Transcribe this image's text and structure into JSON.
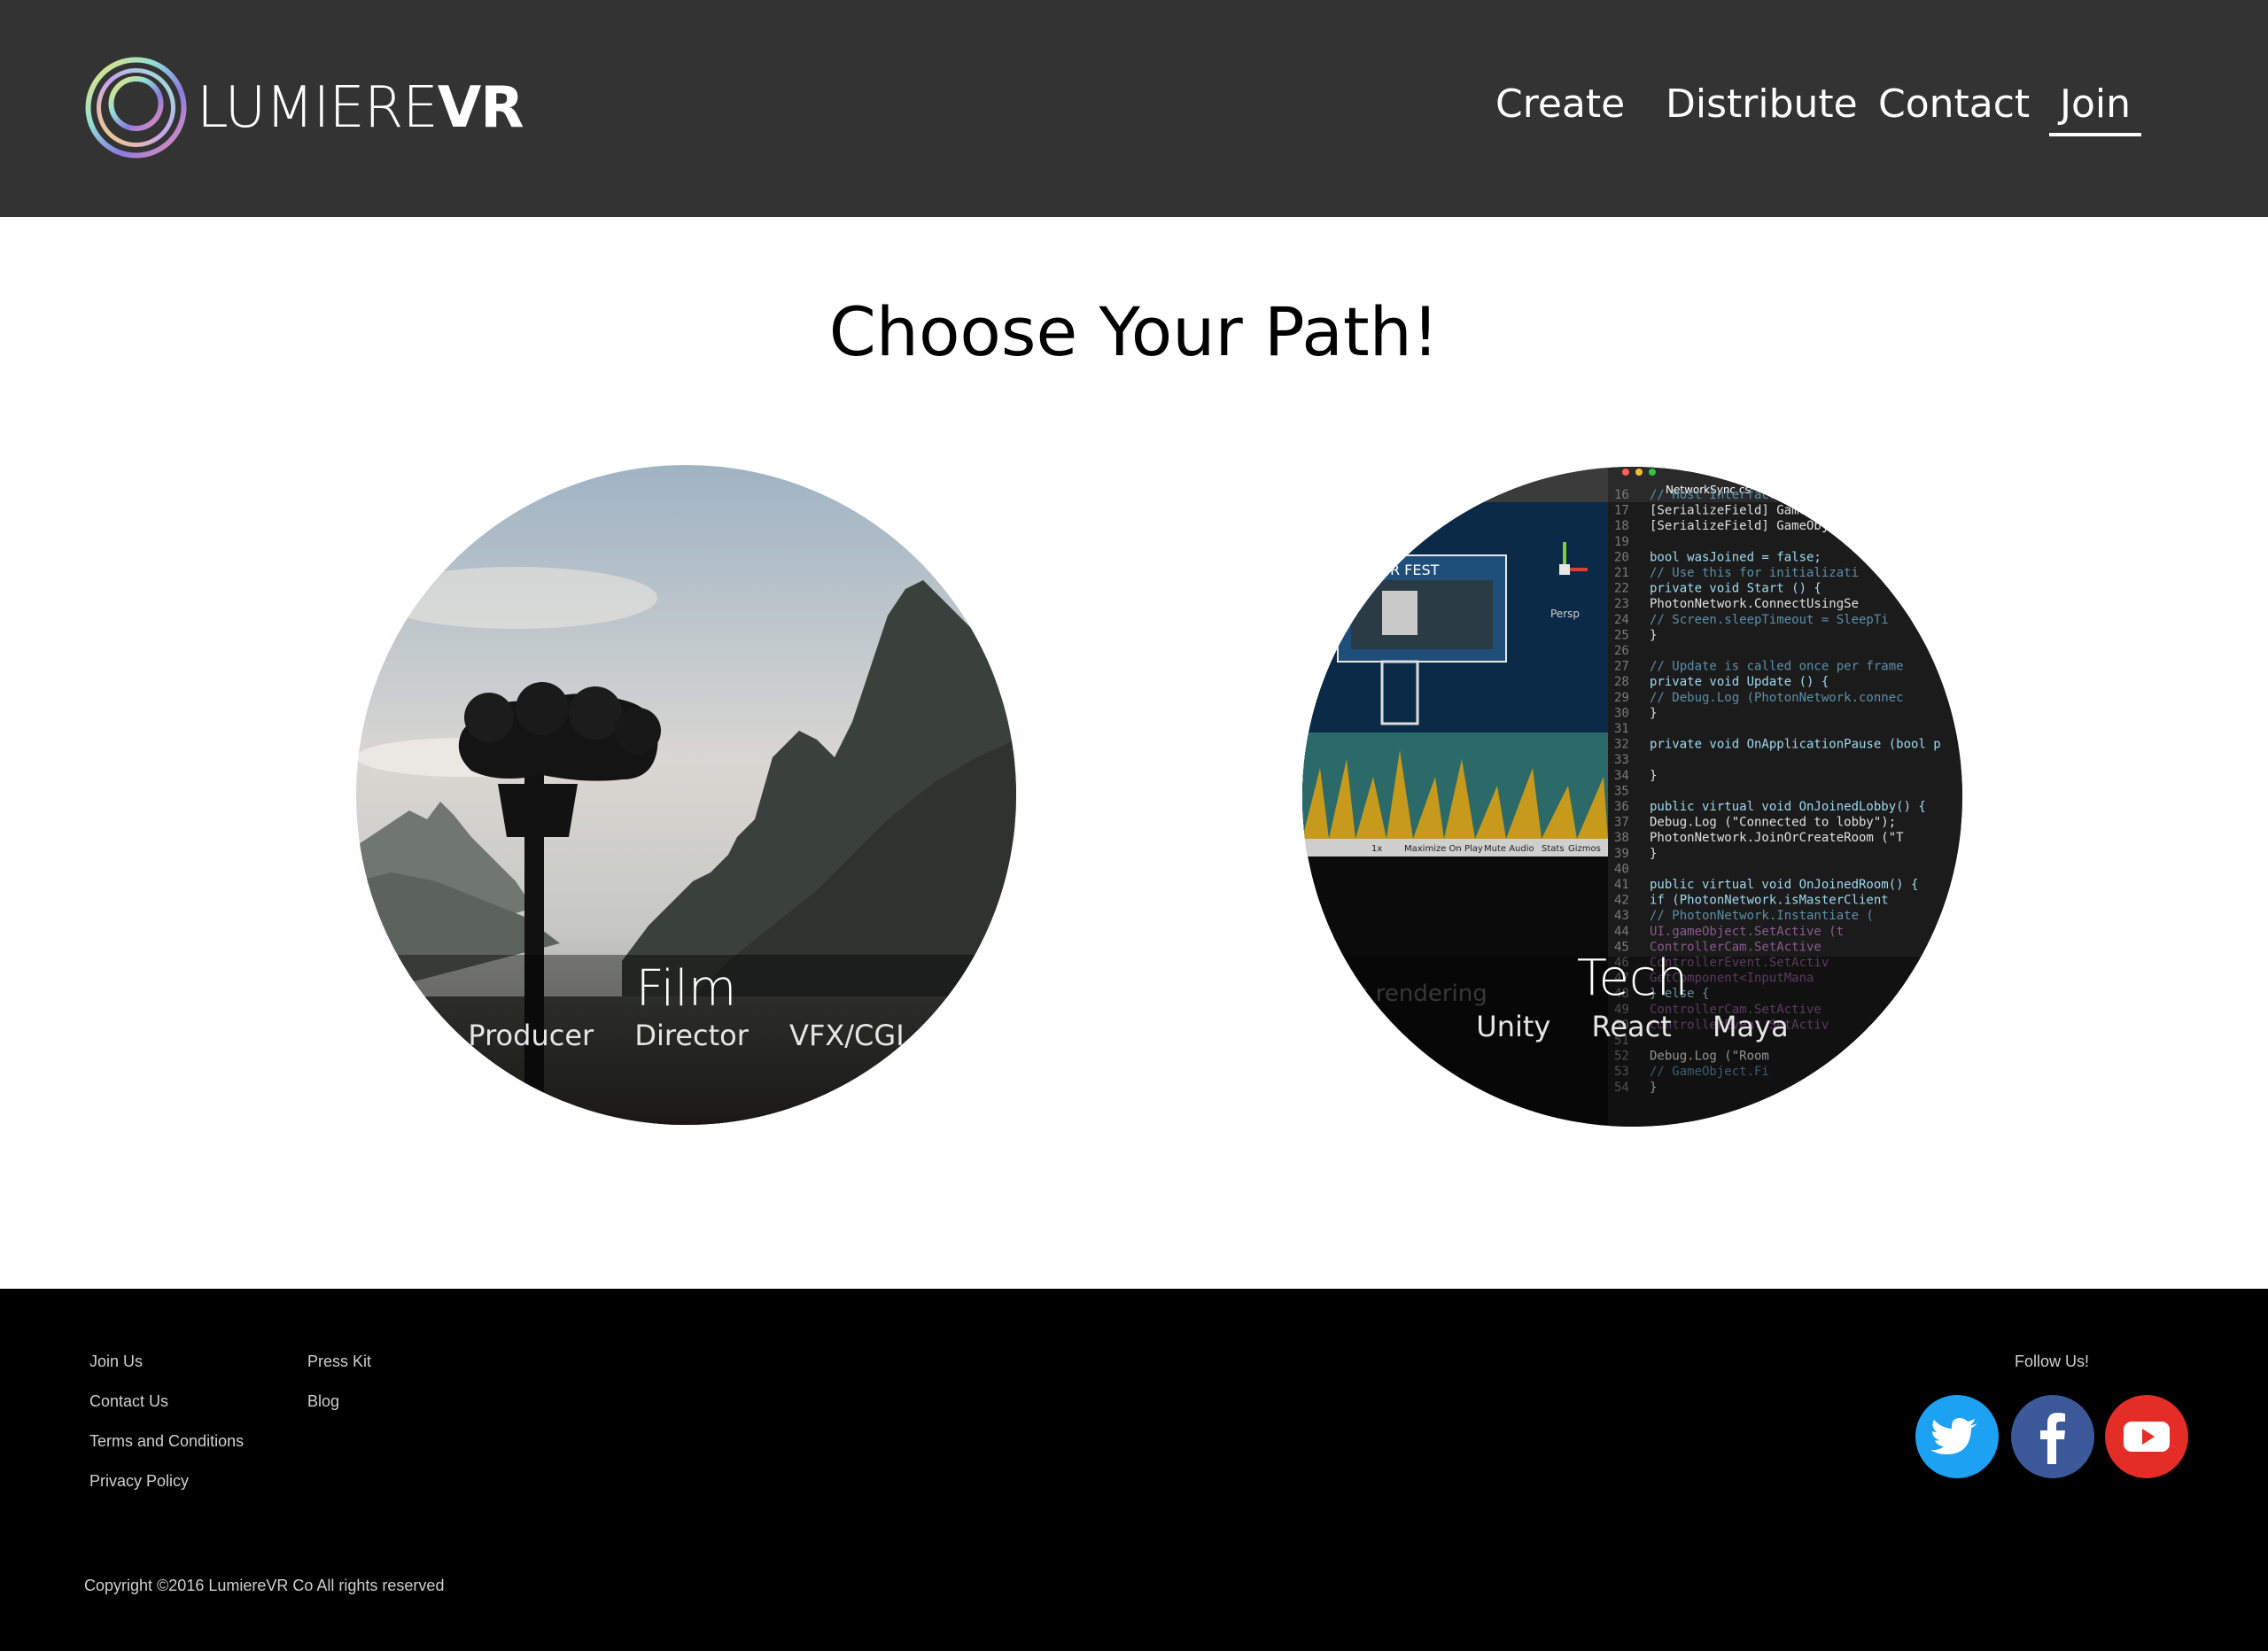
{
  "header": {
    "logo_light": "LUMIERE",
    "logo_bold": "VR",
    "nav": {
      "create": "Create",
      "distribute": "Distribute",
      "contact": "Contact",
      "join": "Join"
    },
    "active_nav": "Join"
  },
  "main": {
    "title": "Choose Your Path!",
    "paths": {
      "film": {
        "title": "Film",
        "roles": [
          "Producer",
          "Director",
          "VFX/CGI"
        ]
      },
      "tech": {
        "title": "Tech",
        "roles": [
          "Unity",
          "React",
          "Maya"
        ]
      }
    },
    "tech_image": {
      "editor_tab": "NetworkSync.cs",
      "fest_label": "VR FEST",
      "persp_label": "Persp",
      "status_text": "as rendering",
      "toolbar": [
        "1x",
        "Maximize On Play",
        "Mute Audio",
        "Stats",
        "Gizmos"
      ],
      "line_numbers": [
        "16",
        "17",
        "18",
        "19",
        "20",
        "21",
        "22",
        "23",
        "24",
        "25",
        "26",
        "27",
        "28",
        "29",
        "30",
        "31",
        "32",
        "33",
        "34",
        "35",
        "36",
        "37",
        "38",
        "39",
        "40",
        "41",
        "42",
        "43",
        "44",
        "45",
        "46",
        "47",
        "48",
        "49",
        "50",
        "51",
        "52",
        "53",
        "54"
      ],
      "code_lines": [
        "    // Host Interface",
        "    [SerializeField] GameO",
        "    [SerializeField] GameObj",
        "",
        "    bool wasJoined = false;",
        "    // Use this for initializati",
        "    private void Start () {",
        "        PhotonNetwork.ConnectUsingSe",
        "//      Screen.sleepTimeout = SleepTi",
        "    }",
        "",
        "    // Update is called once per frame",
        "    private void Update () {",
        "        // Debug.Log (PhotonNetwork.connec",
        "    }",
        "",
        "    private void OnApplicationPause (bool p",
        "",
        "    }",
        "",
        "    public virtual void OnJoinedLobby() {",
        "        Debug.Log (\"Connected to lobby\");",
        "        PhotonNetwork.JoinOrCreateRoom (\"T",
        "    }",
        "",
        "    public virtual void OnJoinedRoom() {",
        "        if (PhotonNetwork.isMasterClient",
        "//          PhotonNetwork.Instantiate (",
        "            UI.gameObject.SetActive (t",
        "            ControllerCam.SetActive",
        "            ControllerEvent.SetActiv",
        "            GetComponent<InputMana",
        "        } else {",
        "            ControllerCam.SetActive",
        "            ControllerEvent.SetActiv",
        "",
        "        Debug.Log (\"Room",
        "//      GameObject.Fi",
        "    }"
      ]
    }
  },
  "footer": {
    "col1": [
      "Join Us",
      "Contact Us",
      "Terms and Conditions",
      "Privacy Policy"
    ],
    "col2": [
      "Press Kit",
      "Blog"
    ],
    "follow_label": "Follow Us!",
    "social": [
      "twitter-icon",
      "facebook-icon",
      "youtube-icon"
    ],
    "copyright": "Copyright ©2016 LumiereVR Co All rights reserved"
  },
  "colors": {
    "header_bg": "#333333",
    "footer_bg": "#000000",
    "twitter": "#1da1f2",
    "facebook": "#3b5998",
    "youtube": "#e52d27"
  }
}
